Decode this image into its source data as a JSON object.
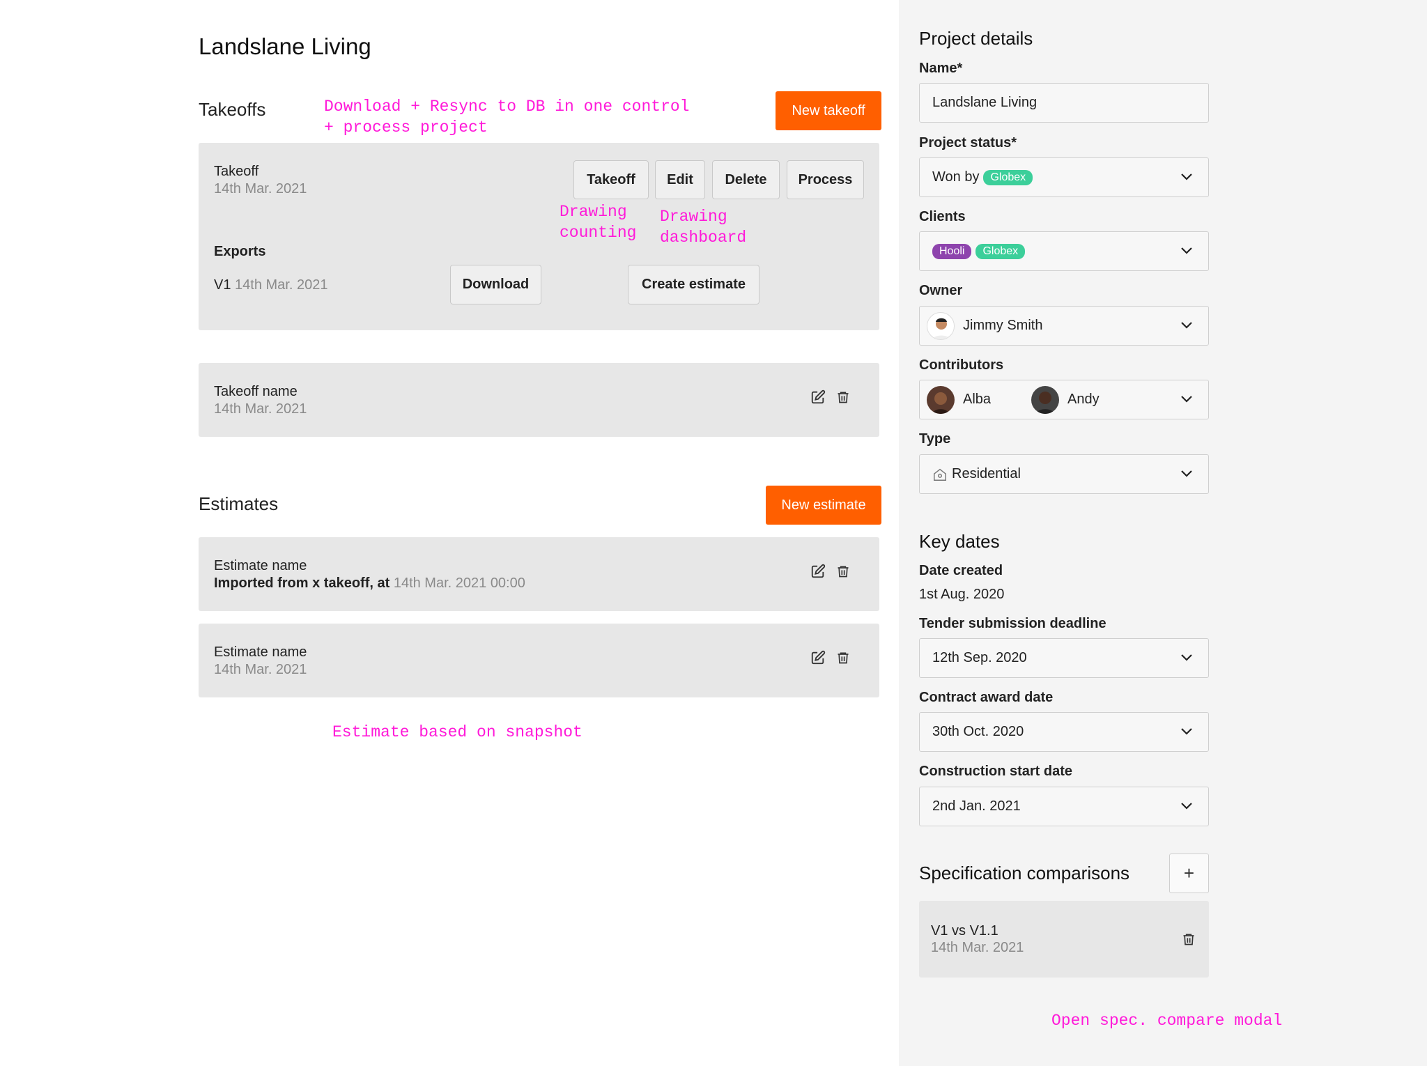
{
  "page": {
    "title": "Landslane Living"
  },
  "takeoffs": {
    "heading": "Takeoffs",
    "new_button": "New takeoff",
    "note": "Download + Resync to DB in one control\n+ process project",
    "card1": {
      "title": "Takeoff",
      "date": "14th Mar. 2021",
      "actions": {
        "takeoff": "Takeoff",
        "edit": "Edit",
        "delete": "Delete",
        "process": "Process"
      },
      "note_counting": "Drawing\ncounting",
      "note_dashboard": "Drawing\ndashboard",
      "exports_label": "Exports",
      "export_version": "V1",
      "export_date": "14th Mar. 2021",
      "download": "Download",
      "create_estimate": "Create estimate"
    },
    "card2": {
      "title": "Takeoff name",
      "date": "14th Mar. 2021"
    }
  },
  "estimates": {
    "heading": "Estimates",
    "new_button": "New estimate",
    "items": [
      {
        "title": "Estimate name",
        "sub_bold": "Imported from x takeoff, at",
        "sub": "14th Mar. 2021 00:00"
      },
      {
        "title": "Estimate name",
        "sub": "14th Mar. 2021"
      }
    ],
    "note": "Estimate based on snapshot"
  },
  "details": {
    "heading": "Project details",
    "name_label": "Name*",
    "name_value": "Landslane Living",
    "status_label": "Project status*",
    "status_prefix": "Won by",
    "status_pill": "Globex",
    "clients_label": "Clients",
    "clients": [
      "Hooli",
      "Globex"
    ],
    "owner_label": "Owner",
    "owner": "Jimmy Smith",
    "contributors_label": "Contributors",
    "contributors": [
      "Alba",
      "Andy"
    ],
    "type_label": "Type",
    "type_value": "Residential"
  },
  "key_dates": {
    "heading": "Key dates",
    "created_label": "Date created",
    "created_value": "1st Aug. 2020",
    "tender_label": "Tender submission deadline",
    "tender_value": "12th Sep. 2020",
    "award_label": "Contract award date",
    "award_value": "30th Oct. 2020",
    "start_label": "Construction start date",
    "start_value": "2nd Jan. 2021"
  },
  "spec": {
    "heading": "Specification comparisons",
    "add": "+",
    "item_title": "V1 vs V1.1",
    "item_date": "14th Mar. 2021",
    "note": "Open spec. compare modal"
  },
  "colors": {
    "accent": "#ff5f00",
    "annotation": "#ff1ad9",
    "globex": "#3ccf9a",
    "hooli": "#8e44ad"
  }
}
